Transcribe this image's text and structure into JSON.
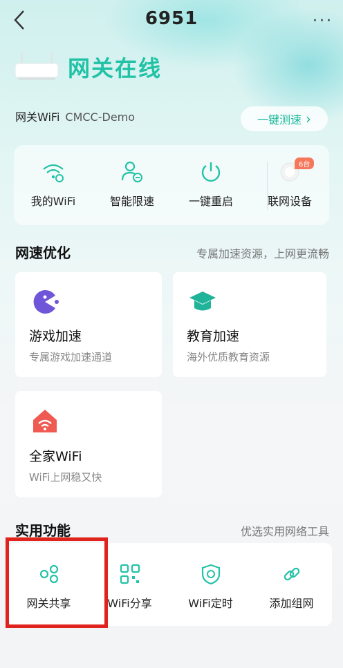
{
  "header": {
    "title": "6951",
    "more_label": "···"
  },
  "status": {
    "text": "网关在线"
  },
  "wifi": {
    "label": "网关WiFi",
    "name": "CMCC-Demo",
    "speedtest_label": "一键测速",
    "speedtest_arrow": "›"
  },
  "quick": [
    {
      "label": "我的WiFi",
      "icon": "wifi-settings-icon"
    },
    {
      "label": "智能限速",
      "icon": "user-speed-icon"
    },
    {
      "label": "一键重启",
      "icon": "power-icon"
    },
    {
      "label": "联网设备",
      "icon": "device-icon",
      "badge": "6台"
    }
  ],
  "optimize": {
    "title": "网速优化",
    "subtitle": "专属加速资源，上网更流畅",
    "cards": [
      {
        "title": "游戏加速",
        "desc": "专属游戏加速通道",
        "icon": "game-icon"
      },
      {
        "title": "教育加速",
        "desc": "海外优质教育资源",
        "icon": "graduation-cap-icon"
      },
      {
        "title": "全家WiFi",
        "desc": "WiFi上网稳又快",
        "icon": "home-wifi-icon"
      }
    ]
  },
  "tools": {
    "title": "实用功能",
    "subtitle": "优选实用网络工具",
    "items": [
      {
        "label": "网关共享",
        "icon": "share-icon"
      },
      {
        "label": "WiFi分享",
        "icon": "qr-code-icon"
      },
      {
        "label": "WiFi定时",
        "icon": "timer-shield-icon"
      },
      {
        "label": "添加组网",
        "icon": "link-icon"
      }
    ]
  },
  "colors": {
    "accent": "#22c2a6",
    "highlight": "#e0231c",
    "badge": "#f5785c"
  }
}
